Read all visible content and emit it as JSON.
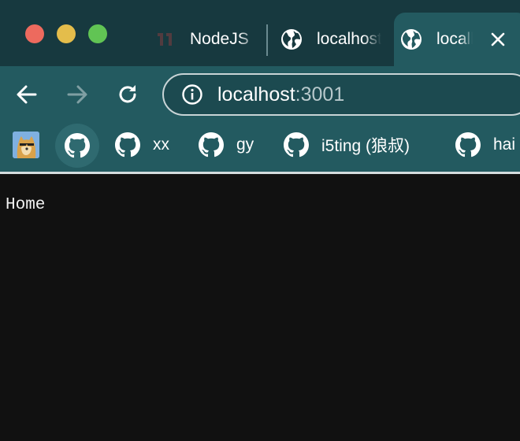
{
  "colors": {
    "tabstrip_bg": "#17393f",
    "toolbar_bg": "#235a60",
    "page_bg": "#111111",
    "traffic_close": "#ed6a5e",
    "traffic_minimize": "#e4bd4b",
    "traffic_maximize": "#61c454"
  },
  "tabs": [
    {
      "title": "NodeJS",
      "icon": "nodejs-icon",
      "active": false
    },
    {
      "title": "localhost",
      "icon": "globe-icon",
      "active": false
    },
    {
      "title": "localhost",
      "icon": "globe-icon",
      "active": true
    }
  ],
  "toolbar": {
    "back_icon": "arrow-left-icon",
    "forward_icon": "arrow-right-icon",
    "reload_icon": "reload-icon"
  },
  "address_bar": {
    "host": "localhost",
    "port": ":3001",
    "icon": "info-icon"
  },
  "bookmarks": [
    {
      "label": "",
      "icon": "doge-avatar-icon"
    },
    {
      "label": "",
      "icon": "github-icon"
    },
    {
      "label": "xx",
      "icon": "github-icon"
    },
    {
      "label": "gy",
      "icon": "github-icon"
    },
    {
      "label": "i5ting (狼叔)",
      "icon": "github-icon"
    },
    {
      "label": "hai",
      "icon": "github-icon"
    }
  ],
  "page": {
    "text": "Home"
  }
}
